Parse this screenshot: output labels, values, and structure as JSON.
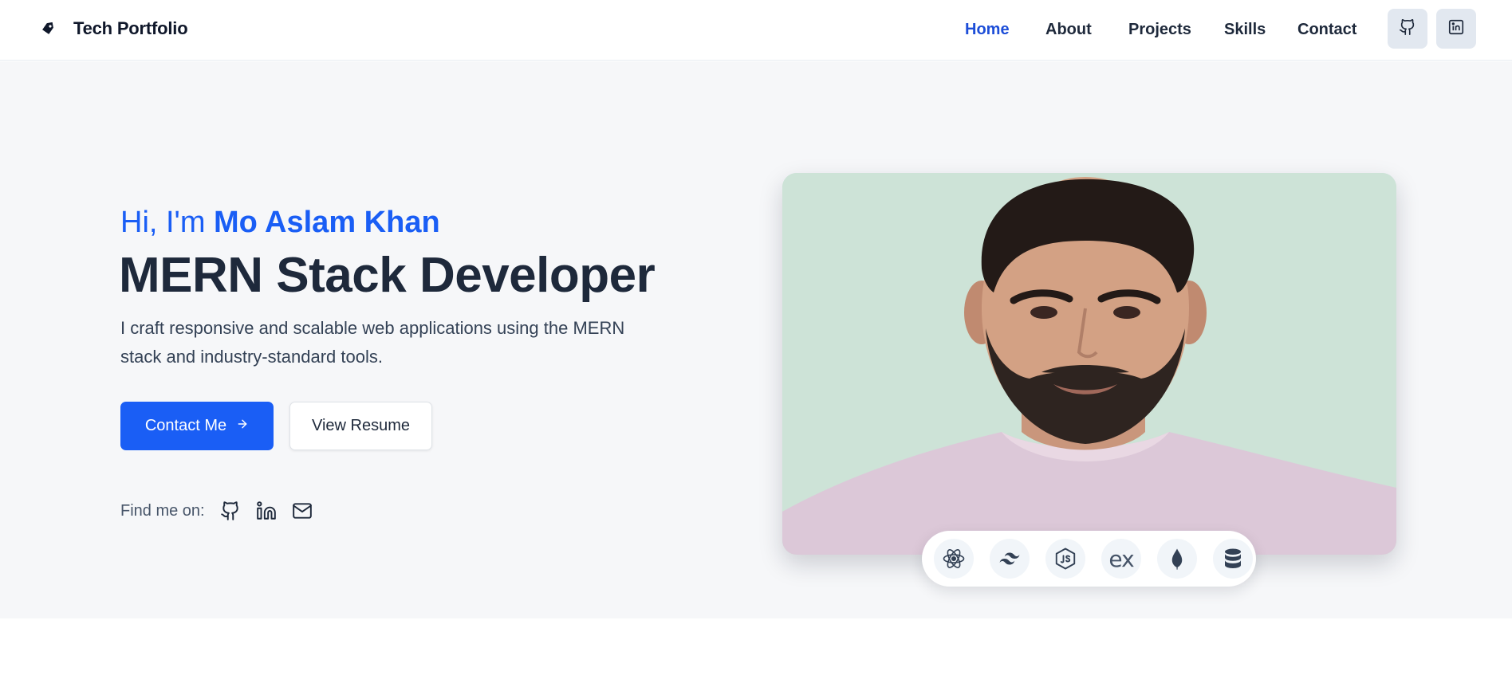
{
  "header": {
    "brand": "Tech Portfolio",
    "nav": [
      {
        "label": "Home",
        "active": true
      },
      {
        "label": "About",
        "active": false
      },
      {
        "label": "Projects",
        "active": false
      },
      {
        "label": "Skills",
        "active": false
      },
      {
        "label": "Contact",
        "active": false
      }
    ],
    "icons": [
      "github-icon",
      "linkedin-icon"
    ]
  },
  "hero": {
    "greeting_prefix": "Hi, I'm ",
    "name": "Mo Aslam Khan",
    "role": "MERN Stack Developer",
    "description": "I craft responsive and scalable web applications using the MERN stack and industry-standard tools.",
    "contact_button": "Contact Me",
    "resume_button": "View Resume",
    "find_me_label": "Find me on:",
    "social_icons": [
      "github-icon",
      "linkedin-icon",
      "mail-icon"
    ]
  },
  "profile": {
    "tech_icons": [
      "react-icon",
      "tailwind-icon",
      "nodejs-icon",
      "express-icon",
      "mongodb-icon",
      "database-icon"
    ],
    "express_label": "ex"
  },
  "colors": {
    "accent": "#1a5ef5",
    "nav_active": "#1d4ed8",
    "text_dark": "#1e293b",
    "hero_bg": "#f6f7f9",
    "photo_bg": "#cde3d7"
  }
}
